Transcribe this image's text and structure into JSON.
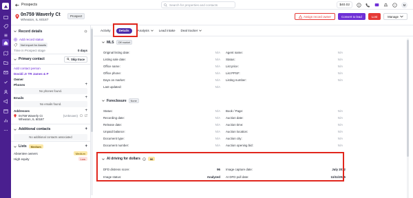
{
  "topbar": {
    "back_label": "Prospects",
    "search_placeholder": "Search for properties and contacts",
    "credits": "$40.02",
    "avatar_initial": "M"
  },
  "property": {
    "address_line1": "0n759 Waverly Ct",
    "address_line2": "Wheaton, IL 60187",
    "status_badge": "Prospect"
  },
  "header_actions": {
    "assign_owner": "Assign record owner",
    "convert": "Convert to lead",
    "lost": "Lost",
    "manage": "Manage"
  },
  "left_panel": {
    "record_details": {
      "title": "Record details",
      "add_status": "Add record status",
      "tag": "Not import for Assets",
      "time_label": "Time in Prospect stage",
      "time_value": "0 days"
    },
    "primary_contact": {
      "title": "Primary contact",
      "skip_trace": "Skip trace",
      "add_person": "Add contact person",
      "person_name": "Dovidi Jr TR James & P",
      "role": "Owner",
      "phones_label": "Phones",
      "phones_empty": "No phones found.",
      "emails_label": "Emails",
      "emails_empty": "No emails found.",
      "addresses_label": "Addresses",
      "address_line1": "0n759 Waverly Ct",
      "address_line2": "Wheaton, IL 60187",
      "address_tag": "(Unknown)"
    },
    "additional_contacts": {
      "title": "Additional contacts",
      "empty": "No additional contacts associated"
    },
    "lists": {
      "title": "Lists",
      "badge": "Medium",
      "items": [
        {
          "name": "Absentee owners",
          "level": "Medium"
        },
        {
          "name": "High equity",
          "level": "Low"
        }
      ]
    }
  },
  "tabs": [
    {
      "label": "Activity"
    },
    {
      "label": "Details"
    },
    {
      "label": "Analysis"
    },
    {
      "label": "Lead intake"
    },
    {
      "label": "Deal tracker"
    }
  ],
  "mls": {
    "title": "MLS",
    "chip": "Off market",
    "left": [
      {
        "label": "Original listing date:",
        "value": "N/A"
      },
      {
        "label": "Listing sale date:",
        "value": "N/A"
      },
      {
        "label": "Office name:",
        "value": "N/A"
      },
      {
        "label": "Office phone:",
        "value": "N/A"
      },
      {
        "label": "Days on market:",
        "value": "N/A"
      },
      {
        "label": "Last updated:",
        "value": "N/A"
      }
    ],
    "right": [
      {
        "label": "Agent name:",
        "value": "N/A"
      },
      {
        "label": "Status:",
        "value": "N/A"
      },
      {
        "label": "List price:",
        "value": "N/A"
      },
      {
        "label": "List PPSF:",
        "value": "N/A"
      },
      {
        "label": "Listing number:",
        "value": "N/A"
      }
    ]
  },
  "foreclosure": {
    "title": "Foreclosure",
    "chip": "None",
    "left": [
      {
        "label": "Status:",
        "value": "N/A"
      },
      {
        "label": "Recording date:",
        "value": "N/A"
      },
      {
        "label": "Release date:",
        "value": "N/A"
      },
      {
        "label": "Unpaid balance:",
        "value": "N/A"
      },
      {
        "label": "Document type:",
        "value": "N/A"
      },
      {
        "label": "Document number:",
        "value": "N/A"
      }
    ],
    "right": [
      {
        "label": "Book / Page:",
        "value": "N/A"
      },
      {
        "label": "Auction date:",
        "value": "N/A"
      },
      {
        "label": "Auction time:",
        "value": "N/A"
      },
      {
        "label": "Auction location:",
        "value": "N/A"
      },
      {
        "label": "Auction city:",
        "value": "N/A"
      },
      {
        "label": "Auction opening bid:",
        "value": "N/A"
      }
    ]
  },
  "ai_driving": {
    "title": "AI driving for dollars",
    "score_badge": "96",
    "left": [
      {
        "label": "DFD distress score:",
        "value": "96"
      },
      {
        "label": "Image status:",
        "value": "Analyzed"
      }
    ],
    "right": [
      {
        "label": "Image capture date:",
        "value": "July 2012"
      },
      {
        "label": "AI DFD pull date:",
        "value": "11/11/2025"
      }
    ]
  },
  "colors": {
    "brand_purple": "#4a1f8f",
    "accent_purple": "#6e2fd6",
    "danger_red": "#e53935",
    "highlight_red": "#e1261c"
  }
}
